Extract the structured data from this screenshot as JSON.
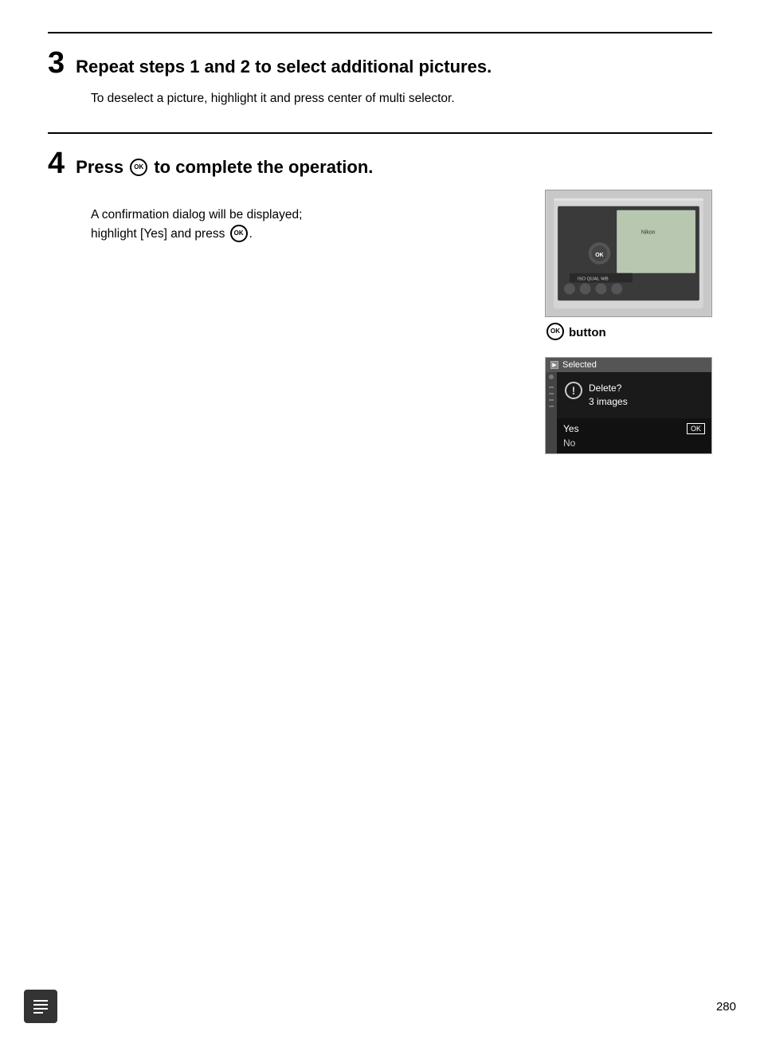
{
  "page": {
    "number": "280"
  },
  "step3": {
    "number": "3",
    "title": "Repeat steps 1 and 2 to select additional pictures.",
    "body": "To deselect a picture, highlight it and press center of multi selector."
  },
  "step4": {
    "number": "4",
    "title_prefix": "Press",
    "title_suffix": "to complete the operation.",
    "ok_symbol": "OK",
    "button_label": "button",
    "dialog": {
      "titlebar": "Selected",
      "warning_text_line1": "Delete?",
      "warning_text_line2": "3 images",
      "yes_label": "Yes",
      "no_label": "No",
      "ok_badge": "OK"
    },
    "confirmation_line1": "A confirmation dialog will be displayed;",
    "confirmation_line2": "highlight [Yes] and press"
  }
}
